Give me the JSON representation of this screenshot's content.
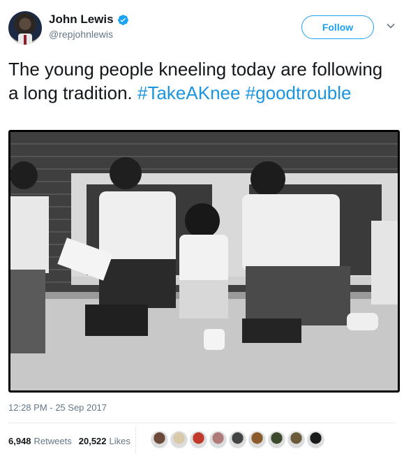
{
  "author": {
    "display_name": "John Lewis",
    "handle": "@repjohnlewis",
    "verified": true
  },
  "follow_label": "Follow",
  "tweet": {
    "text_plain": "The young people kneeling today are following a long tradition. ",
    "hashtag_1": "#TakeAKnee",
    "hashtag_2": "#goodtrouble"
  },
  "photo": {
    "description_icon": "photo-black-and-white"
  },
  "timestamp": "12:28 PM - 25 Sep 2017",
  "stats": {
    "retweets_count": "6,948",
    "retweets_label": "Retweets",
    "likes_count": "20,522",
    "likes_label": "Likes"
  },
  "liker_avatars": [
    {
      "color": "#6b4a3a"
    },
    {
      "color": "#d8c9a8"
    },
    {
      "color": "#c0392b"
    },
    {
      "color": "#b07a7a"
    },
    {
      "color": "#444444"
    },
    {
      "color": "#8a5a2a"
    },
    {
      "color": "#3a4a2a"
    },
    {
      "color": "#6a5a3a"
    },
    {
      "color": "#1a1a1a"
    }
  ],
  "colors": {
    "accent": "#1da1f2",
    "hashtag": "#1b95e0",
    "muted": "#657786"
  }
}
